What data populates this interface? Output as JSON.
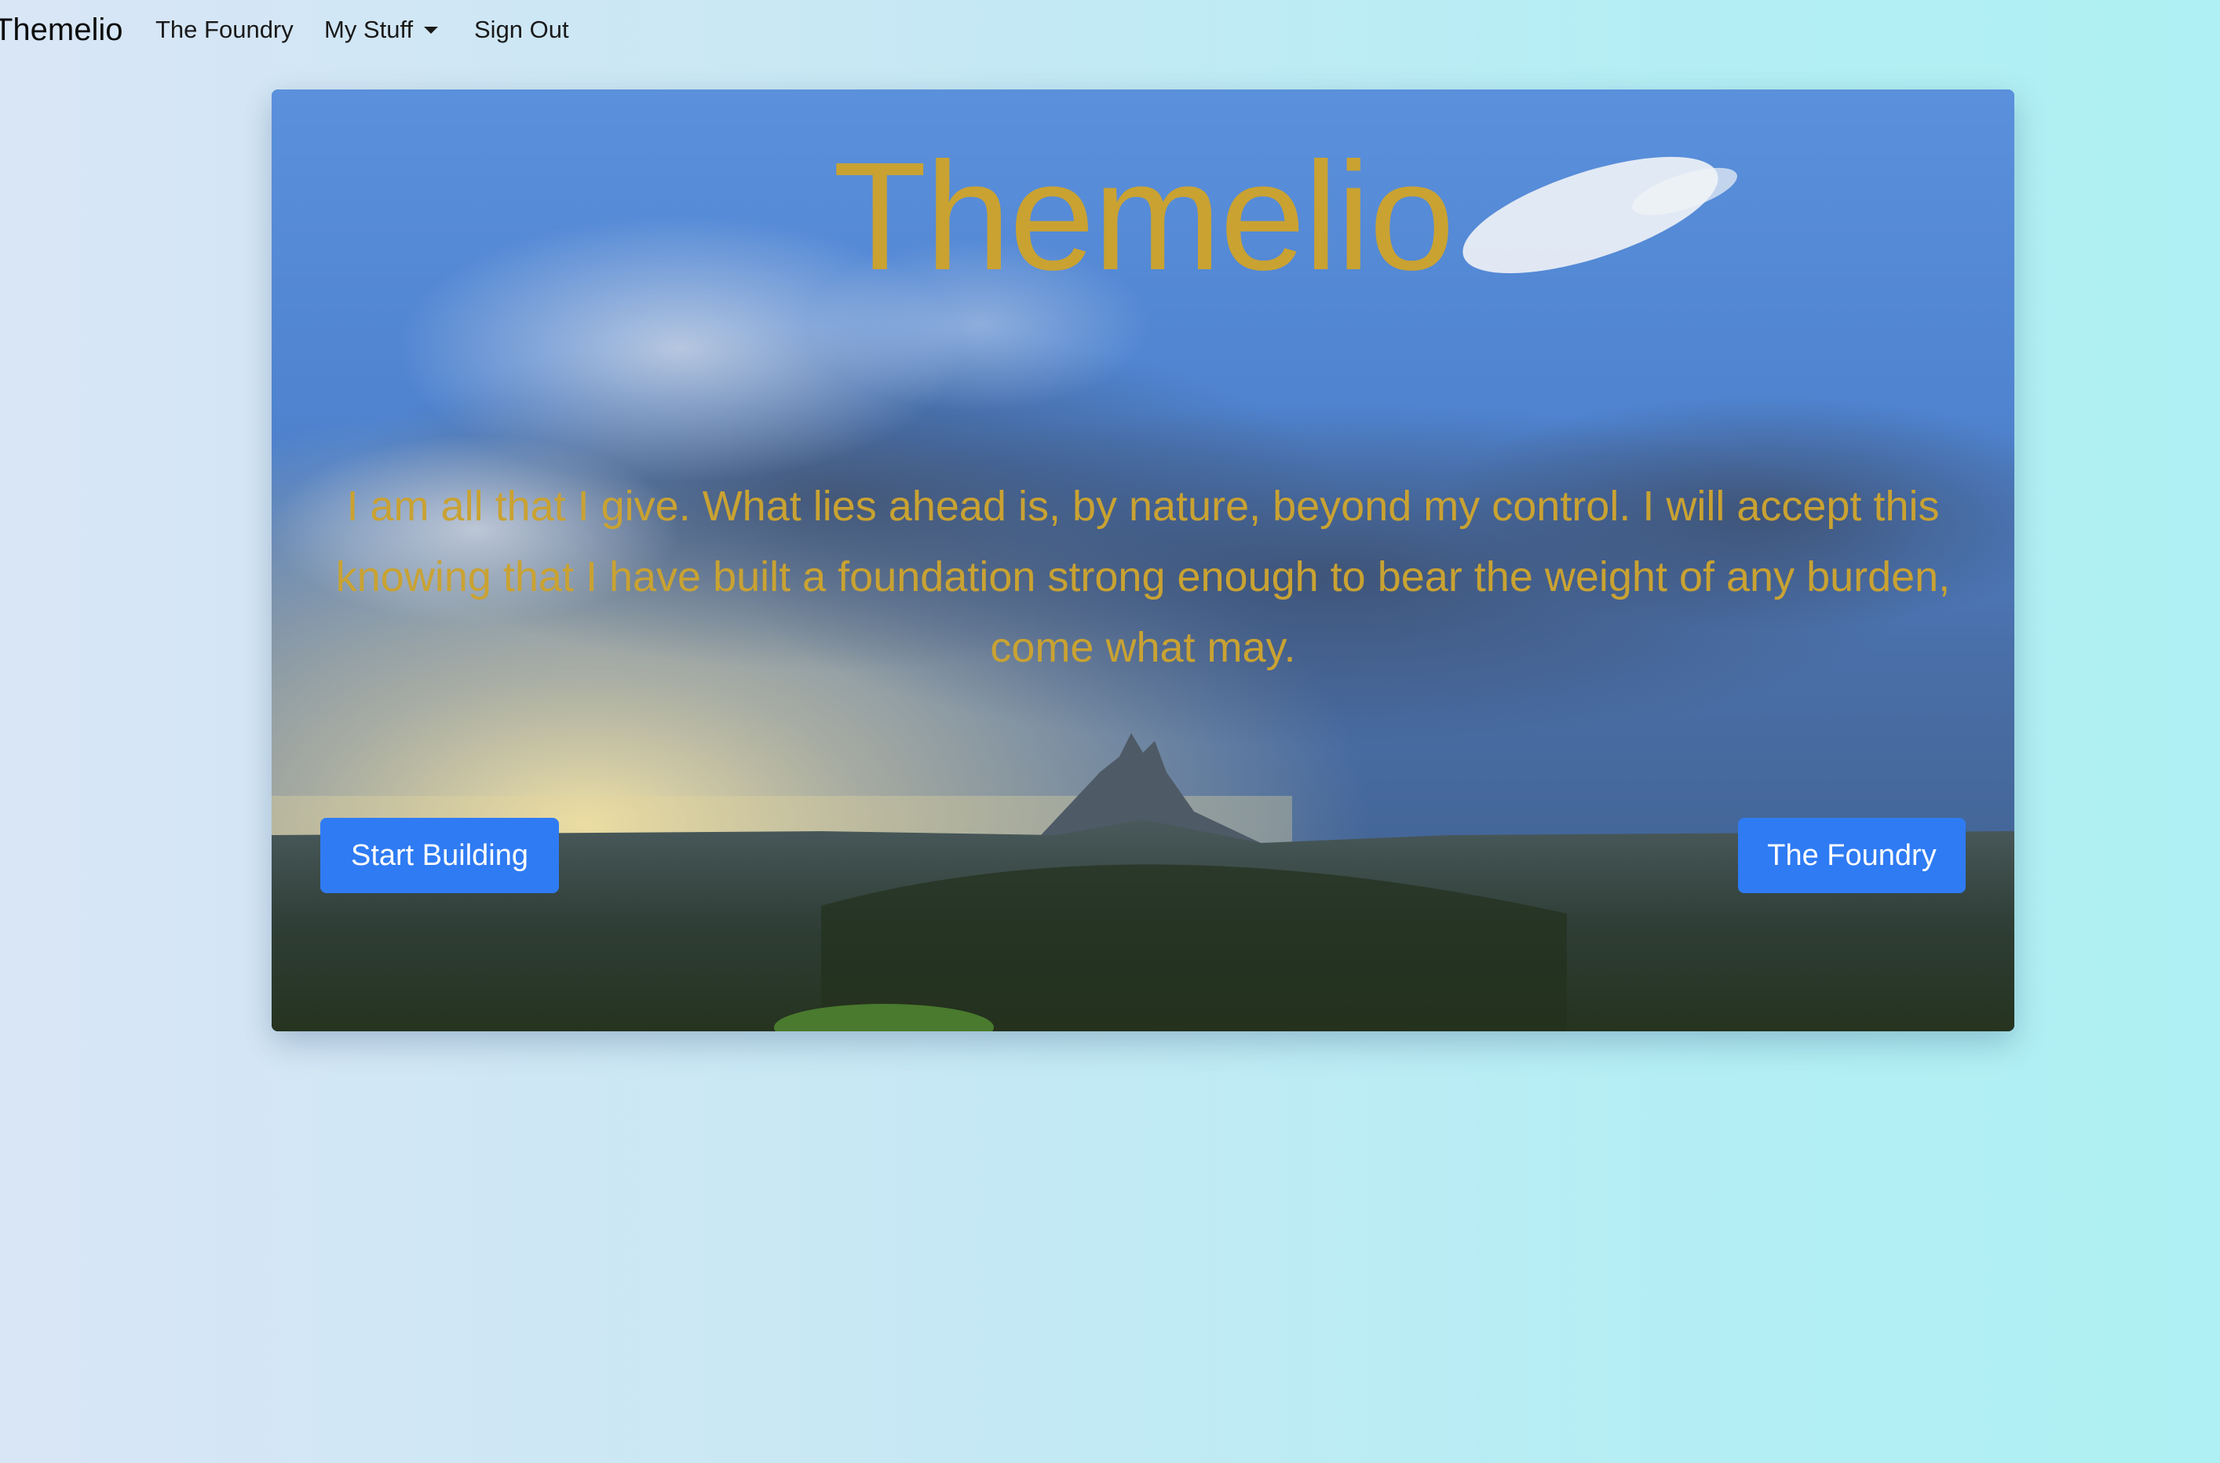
{
  "navbar": {
    "brand": "Themelio",
    "links": {
      "foundry": "The Foundry",
      "my_stuff": "My Stuff",
      "sign_out": "Sign Out"
    }
  },
  "hero": {
    "title": "Themelio",
    "quote": "I am all that I give. What lies ahead is, by nature, beyond my control. I will accept this knowing that I have built a foundation strong enough to bear the weight of any burden, come what may.",
    "buttons": {
      "start_building": "Start Building",
      "the_foundry": "The Foundry"
    },
    "background": "mountain-landscape-photo"
  },
  "colors": {
    "accent_gold": "#c9a232",
    "button_blue": "#2f7bf3"
  },
  "icons": {
    "dropdown": "caret-down-icon"
  }
}
